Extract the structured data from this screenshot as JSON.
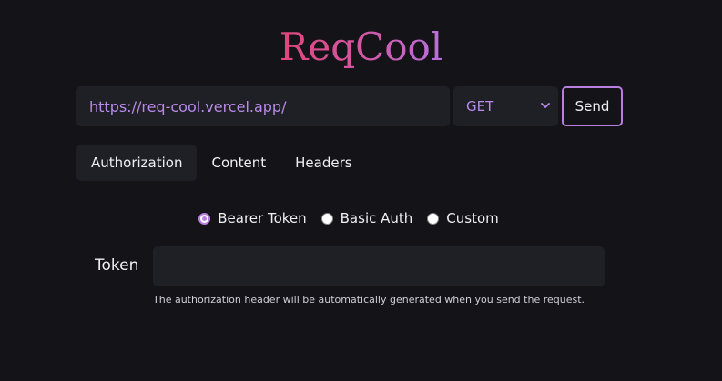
{
  "app": {
    "logo_text": "ReqCool"
  },
  "request": {
    "url": "https://req-cool.vercel.app/",
    "method": "GET",
    "send_label": "Send"
  },
  "tabs": [
    {
      "label": "Authorization",
      "active": true
    },
    {
      "label": "Content",
      "active": false
    },
    {
      "label": "Headers",
      "active": false
    }
  ],
  "auth": {
    "options": [
      {
        "label": "Bearer Token",
        "selected": true
      },
      {
        "label": "Basic Auth",
        "selected": false
      },
      {
        "label": "Custom",
        "selected": false
      }
    ],
    "token_label": "Token",
    "token_value": "",
    "hint": "The authorization header will be automatically generated when you send the request."
  },
  "colors": {
    "background": "#131318",
    "field": "#1f1f26",
    "accent": "#b97fe0",
    "logo_start": "#e0457b",
    "logo_end": "#b870de"
  }
}
